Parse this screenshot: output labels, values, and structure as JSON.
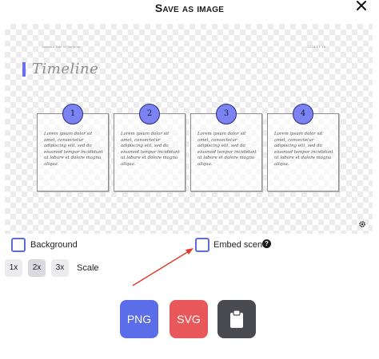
{
  "dialog": {
    "title": "Save as image",
    "close_icon": "close-icon"
  },
  "preview": {
    "tiny_left": "Autumn Tale of Sequoia",
    "tiny_right": "2024-11-18",
    "timeline_title": "Timeline",
    "cards": [
      {
        "number": "1",
        "text": "Lorem ipsum dolor sit amet, consectetur adipiscing elit, sed do eiusmod tempor incididunt ut labore et dolore magna aliqua."
      },
      {
        "number": "2",
        "text": "Lorem ipsum dolor sit amet, consectetur adipiscing elit, sed do eiusmod tempor incididunt ut labore et dolore magna aliqua."
      },
      {
        "number": "3",
        "text": "Lorem ipsum dolor sit amet, consectetur adipiscing elit, sed do eiusmod tempor incididunt ut labore et dolore magna aliqua."
      },
      {
        "number": "4",
        "text": "Lorem ipsum dolor sit amet, consectetur adipiscing elit, sed do eiusmod tempor incididunt ut labore et dolore magna aliqua."
      }
    ],
    "settings_icon": "gear-icon"
  },
  "options": {
    "background_label": "Background",
    "background_checked": false,
    "embed_label": "Embed scene",
    "embed_checked": false,
    "help_glyph": "?"
  },
  "scale": {
    "options": [
      "1x",
      "2x",
      "3x"
    ],
    "selected": "2x",
    "label": "Scale"
  },
  "export": {
    "png_label": "PNG",
    "svg_label": "SVG",
    "clipboard_icon": "clipboard-icon",
    "colors": {
      "png": "#5b6de8",
      "svg": "#e8575a",
      "clipboard": "#4a4b50"
    }
  },
  "colors": {
    "accent": "#5d6bdc",
    "annotation_arrow": "#e23b2b"
  }
}
